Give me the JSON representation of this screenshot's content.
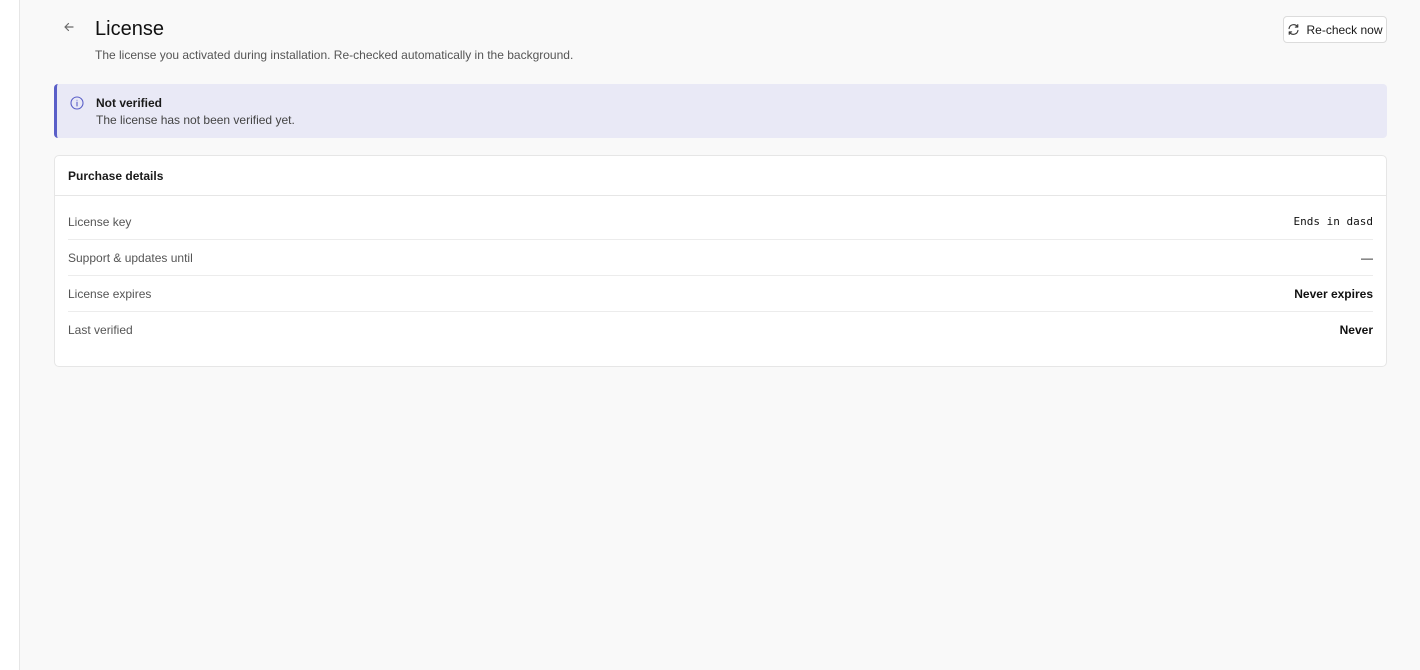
{
  "header": {
    "title": "License",
    "subtitle": "The license you activated during installation. Re-checked automatically in the background.",
    "recheck_label": "Re-check now"
  },
  "alert": {
    "title": "Not verified",
    "message": "The license has not been verified yet."
  },
  "purchase": {
    "title": "Purchase details",
    "rows": [
      {
        "label": "License key",
        "value": "Ends in dasd"
      },
      {
        "label": "Support & updates until",
        "value": "—"
      },
      {
        "label": "License expires",
        "value": "Never expires"
      },
      {
        "label": "Last verified",
        "value": "Never"
      }
    ]
  },
  "colors": {
    "alert_accent": "#5a5fc8",
    "alert_background": "#e9e9f6"
  },
  "icons": {
    "back": "arrow-left-icon",
    "recheck": "refresh-icon",
    "alert": "info-icon"
  }
}
